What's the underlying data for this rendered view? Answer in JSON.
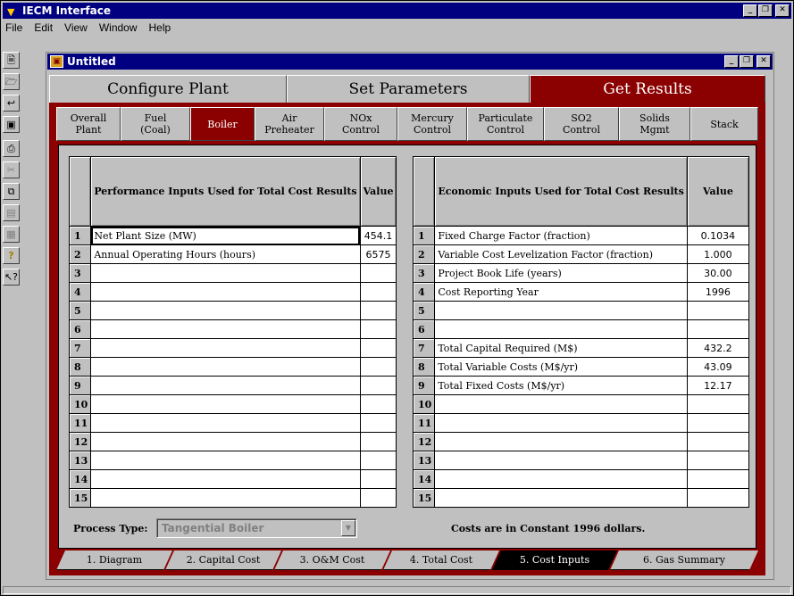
{
  "app": {
    "title": "IECM Interface",
    "menu": [
      "File",
      "Edit",
      "View",
      "Window",
      "Help"
    ]
  },
  "toolbar": {
    "icons": [
      "new-icon",
      "open-icon",
      "import-icon",
      "save-icon",
      "print-icon",
      "cut-icon",
      "copy-icon",
      "paste-icon",
      "properties-icon",
      "help-icon",
      "context-help-icon"
    ]
  },
  "child": {
    "title": "Untitled"
  },
  "main_tabs": [
    "Configure Plant",
    "Set Parameters",
    "Get Results"
  ],
  "sub_tabs": [
    {
      "l1": "Overall",
      "l2": "Plant"
    },
    {
      "l1": "Fuel",
      "l2": "(Coal)"
    },
    {
      "l1": "Boiler",
      "l2": ""
    },
    {
      "l1": "Air",
      "l2": "Preheater"
    },
    {
      "l1": "NOx",
      "l2": "Control"
    },
    {
      "l1": "Mercury",
      "l2": "Control"
    },
    {
      "l1": "Particulate",
      "l2": "Control"
    },
    {
      "l1": "SO2",
      "l2": "Control"
    },
    {
      "l1": "Solids",
      "l2": "Mgmt"
    },
    {
      "l1": "Stack",
      "l2": ""
    }
  ],
  "performance": {
    "header": "Performance Inputs Used for Total Cost Results",
    "value_header": "Value",
    "rows": [
      {
        "n": "1",
        "label": "Net Plant Size (MW)",
        "value": "454.1"
      },
      {
        "n": "2",
        "label": "Annual Operating Hours (hours)",
        "value": "6575"
      },
      {
        "n": "3",
        "label": "",
        "value": ""
      },
      {
        "n": "4",
        "label": "",
        "value": ""
      },
      {
        "n": "5",
        "label": "",
        "value": ""
      },
      {
        "n": "6",
        "label": "",
        "value": ""
      },
      {
        "n": "7",
        "label": "",
        "value": ""
      },
      {
        "n": "8",
        "label": "",
        "value": ""
      },
      {
        "n": "9",
        "label": "",
        "value": ""
      },
      {
        "n": "10",
        "label": "",
        "value": ""
      },
      {
        "n": "11",
        "label": "",
        "value": ""
      },
      {
        "n": "12",
        "label": "",
        "value": ""
      },
      {
        "n": "13",
        "label": "",
        "value": ""
      },
      {
        "n": "14",
        "label": "",
        "value": ""
      },
      {
        "n": "15",
        "label": "",
        "value": ""
      }
    ]
  },
  "economic": {
    "header": "Economic Inputs Used for Total Cost Results",
    "value_header": "Value",
    "rows": [
      {
        "n": "1",
        "label": "Fixed Charge Factor (fraction)",
        "value": "0.1034"
      },
      {
        "n": "2",
        "label": "Variable Cost Levelization Factor (fraction)",
        "value": "1.000"
      },
      {
        "n": "3",
        "label": "Project Book Life (years)",
        "value": "30.00"
      },
      {
        "n": "4",
        "label": "Cost Reporting Year",
        "value": "1996"
      },
      {
        "n": "5",
        "label": "",
        "value": ""
      },
      {
        "n": "6",
        "label": "",
        "value": ""
      },
      {
        "n": "7",
        "label": "Total Capital Required (M$)",
        "value": "432.2"
      },
      {
        "n": "8",
        "label": "Total Variable Costs (M$/yr)",
        "value": "43.09"
      },
      {
        "n": "9",
        "label": "Total Fixed Costs (M$/yr)",
        "value": "12.17"
      },
      {
        "n": "10",
        "label": "",
        "value": ""
      },
      {
        "n": "11",
        "label": "",
        "value": ""
      },
      {
        "n": "12",
        "label": "",
        "value": ""
      },
      {
        "n": "13",
        "label": "",
        "value": ""
      },
      {
        "n": "14",
        "label": "",
        "value": ""
      },
      {
        "n": "15",
        "label": "",
        "value": ""
      }
    ]
  },
  "process": {
    "label": "Process Type:",
    "value": "Tangential Boiler"
  },
  "costs_note": "Costs are in Constant 1996 dollars.",
  "bottom_tabs": [
    "1. Diagram",
    "2. Capital Cost",
    "3. O&M Cost",
    "4. Total Cost",
    "5. Cost Inputs",
    "6. Gas Summary"
  ],
  "colors": {
    "accent": "#8b0000",
    "titlebar": "#000080"
  }
}
